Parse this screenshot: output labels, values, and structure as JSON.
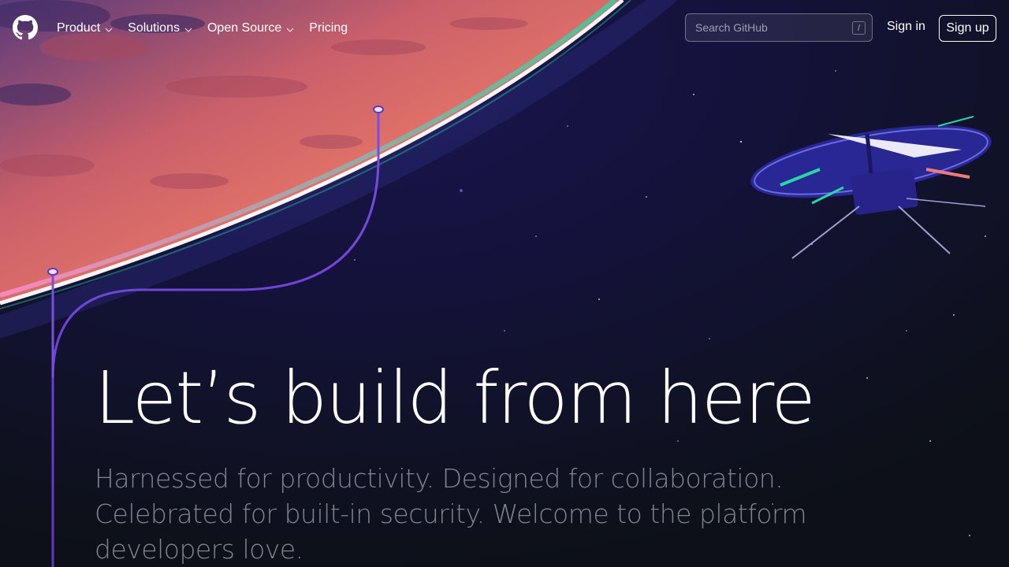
{
  "nav": {
    "items": [
      {
        "label": "Product",
        "has_dropdown": true
      },
      {
        "label": "Solutions",
        "has_dropdown": true
      },
      {
        "label": "Open Source",
        "has_dropdown": true
      },
      {
        "label": "Pricing",
        "has_dropdown": false
      }
    ],
    "search": {
      "placeholder": "Search GitHub",
      "shortcut": "/"
    },
    "sign_in": "Sign in",
    "sign_up": "Sign up"
  },
  "hero": {
    "headline": "Let’s build from here",
    "subhead": "Harnessed for productivity. Designed for collaboration. Celebrated for built-in security. Welcome to the platform developers love."
  },
  "icons": {
    "logo": "github-mark-icon",
    "dropdown": "chevron-down-icon"
  },
  "colors": {
    "background": "#0d1117",
    "planet": "#e8735f",
    "accent_line": "#6e40c9",
    "subhead": "#7d8590"
  }
}
